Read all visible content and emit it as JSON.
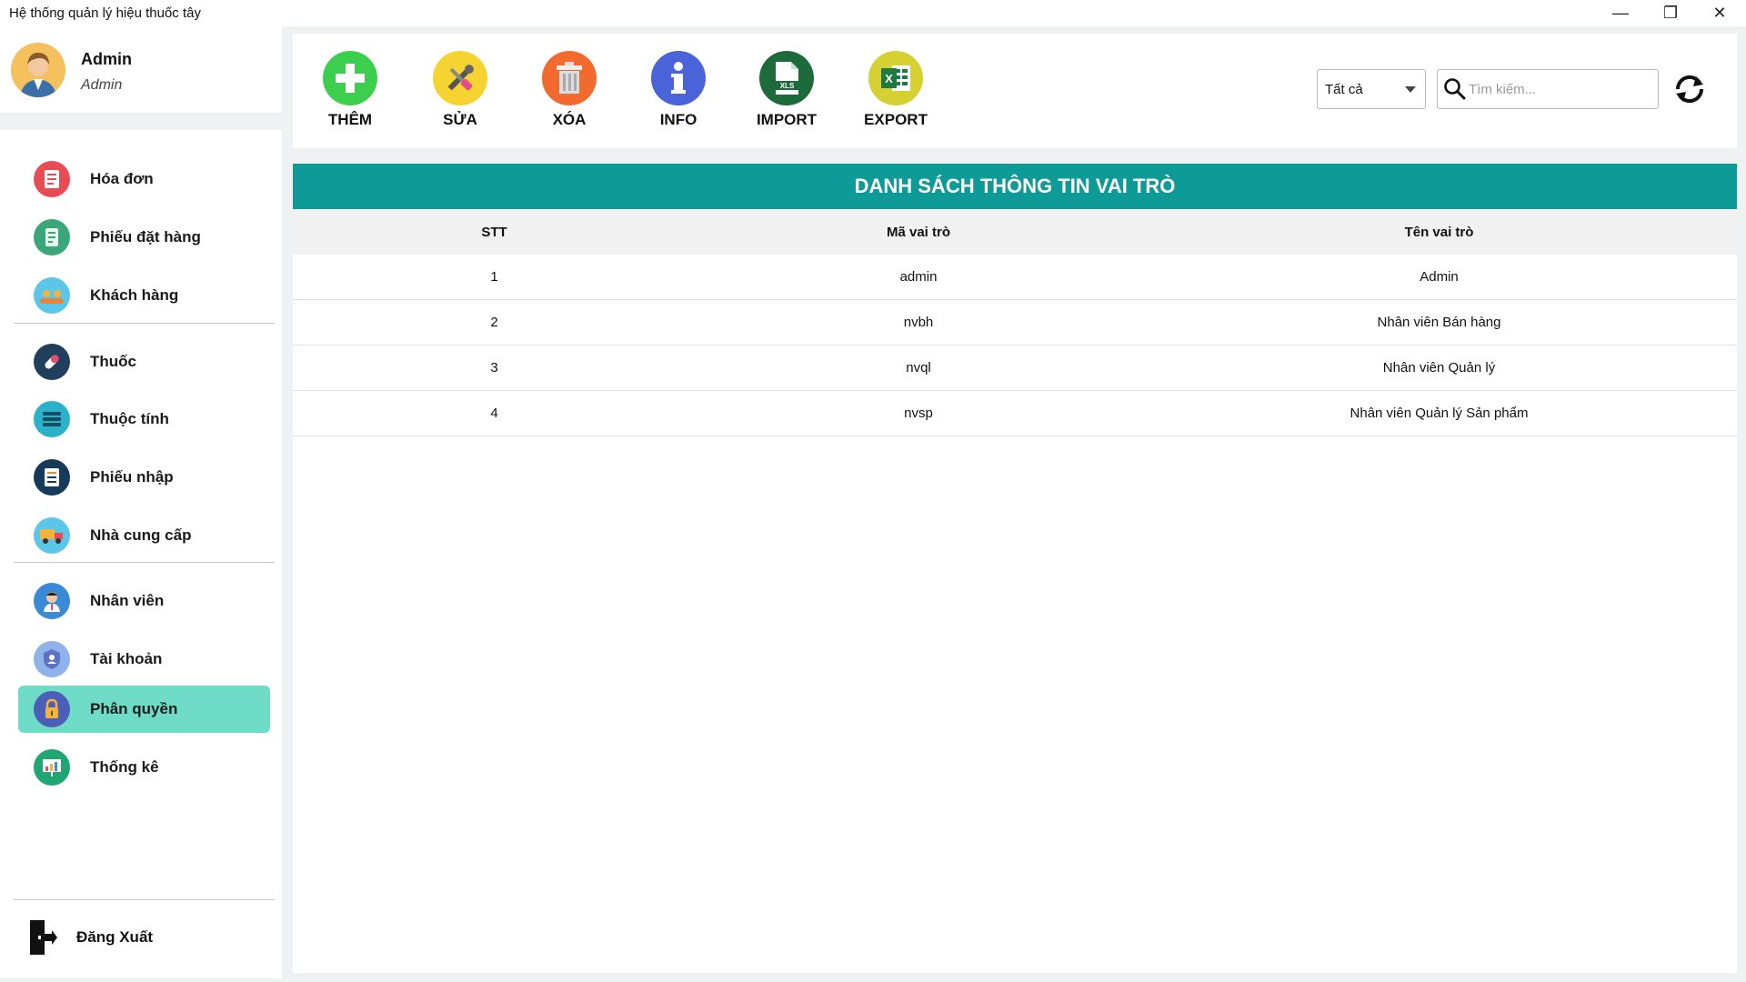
{
  "window": {
    "title": "Hệ thống quản lý hiệu thuốc tây",
    "minimize": "—",
    "maximize": "❐",
    "close": "✕"
  },
  "profile": {
    "name": "Admin",
    "role": "Admin"
  },
  "sidebar": {
    "items": [
      {
        "label": "Hóa đơn",
        "icon": "invoice-icon",
        "color": "#e94b55"
      },
      {
        "label": "Phiếu đặt hàng",
        "icon": "order-form-icon",
        "color": "#3aa77a"
      },
      {
        "label": "Khách hàng",
        "icon": "customers-icon",
        "color": "#5bc6e8"
      },
      {
        "label": "Thuốc",
        "icon": "pill-icon",
        "color": "#1f3f5c"
      },
      {
        "label": "Thuộc tính",
        "icon": "attribute-list-icon",
        "color": "#2ab2c9"
      },
      {
        "label": "Phiếu nhập",
        "icon": "import-slip-icon",
        "color": "#163a5a"
      },
      {
        "label": "Nhà cung cấp",
        "icon": "supplier-truck-icon",
        "color": "#5bc6e8"
      },
      {
        "label": "Nhân viên",
        "icon": "employee-icon",
        "color": "#3b8ad6"
      },
      {
        "label": "Tài khoản",
        "icon": "account-shield-icon",
        "color": "#8fb2e8"
      },
      {
        "label": "Phân quyền",
        "icon": "permission-lock-icon",
        "color": "#4c5fb8"
      },
      {
        "label": "Thống kê",
        "icon": "statistics-chart-icon",
        "color": "#1fa672"
      }
    ],
    "active_index": 9,
    "logout": "Đăng Xuất"
  },
  "toolbar": {
    "add": "THÊM",
    "edit": "SỬA",
    "delete": "XÓA",
    "info": "INFO",
    "import": "IMPORT",
    "export": "EXPORT"
  },
  "filter": {
    "selected": "Tất cả"
  },
  "search": {
    "placeholder": "Tìm kiếm..."
  },
  "table": {
    "title": "DANH SÁCH THÔNG TIN VAI TRÒ",
    "headers": [
      "STT",
      "Mã vai trò",
      "Tên vai trò"
    ],
    "rows": [
      [
        "1",
        "admin",
        "Admin"
      ],
      [
        "2",
        "nvbh",
        "Nhân viên Bán hàng"
      ],
      [
        "3",
        "nvql",
        "Nhân viên Quản lý"
      ],
      [
        "4",
        "nvsp",
        "Nhân viên Quản lý Sản phẩm"
      ]
    ]
  },
  "colors": {
    "accent": "#0e9a96",
    "active_menu": "#6fdcc8"
  }
}
